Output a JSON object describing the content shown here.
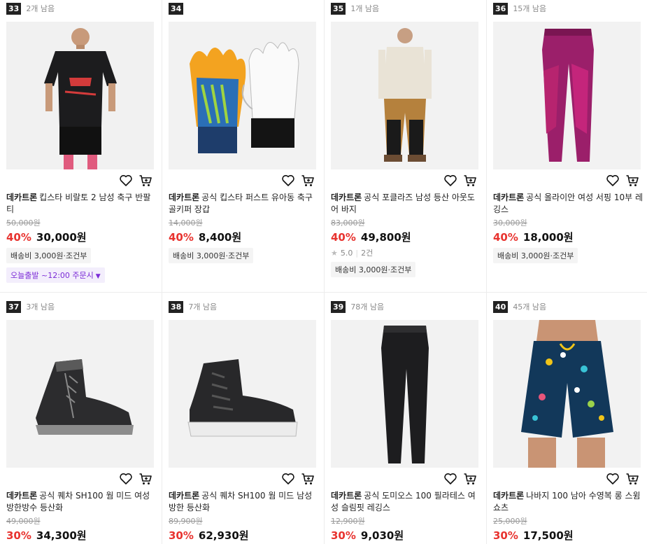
{
  "products": [
    {
      "rank": "33",
      "stock": "2개 남음",
      "brand": "데카트론",
      "name": "킵스타 비랄토 2 남성 축구 반팔티",
      "original_price": "50,000원",
      "discount": "40%",
      "price": "30,000원",
      "shipping": "배송비 3,000원·조건부",
      "promo": "오늘출발 ~12:00 주문시",
      "image": "soccer-shirt"
    },
    {
      "rank": "34",
      "stock": "",
      "brand": "데카트론",
      "name": "공식 킵스타 퍼스트 유아동 축구 골키퍼 장갑",
      "original_price": "14,000원",
      "discount": "40%",
      "price": "8,400원",
      "shipping": "배송비 3,000원·조건부",
      "image": "goalkeeper-gloves"
    },
    {
      "rank": "35",
      "stock": "1개 남음",
      "brand": "데카트론",
      "name": "공식 포클라즈 남성 등산 아웃도어 바지",
      "original_price": "83,000원",
      "discount": "40%",
      "price": "49,800원",
      "rating": "5.0",
      "reviews": "2건",
      "shipping": "배송비 3,000원·조건부",
      "image": "hiking-pants"
    },
    {
      "rank": "36",
      "stock": "15개 남음",
      "brand": "데카트론",
      "name": "공식 올라이안 여성 서핑 10부 레깅스",
      "original_price": "30,000원",
      "discount": "40%",
      "price": "18,000원",
      "shipping": "배송비 3,000원·조건부",
      "image": "surf-leggings"
    },
    {
      "rank": "37",
      "stock": "3개 남음",
      "brand": "데카트론",
      "name": "공식 퀘차 SH100 웜 미드 여성 방한방수 등산화",
      "original_price": "49,000원",
      "discount": "30%",
      "price": "34,300원",
      "image": "womens-boot"
    },
    {
      "rank": "38",
      "stock": "7개 남음",
      "brand": "데카트론",
      "name": "공식 퀘차 SH100 웜 미드 남성 방한 등산화",
      "original_price": "89,900원",
      "discount": "30%",
      "price": "62,930원",
      "image": "mens-boot"
    },
    {
      "rank": "39",
      "stock": "78개 남음",
      "brand": "데카트론",
      "name": "공식 도미오스 100 필라테스 여성 슬림핏 레깅스",
      "original_price": "12,900원",
      "discount": "30%",
      "price": "9,030원",
      "image": "pilates-leggings"
    },
    {
      "rank": "40",
      "stock": "45개 남음",
      "brand": "데카트론",
      "name": "나바지 100 남아 수영복 롱 스윔 쇼츠",
      "original_price": "25,000원",
      "discount": "30%",
      "price": "17,500원",
      "image": "swim-shorts"
    }
  ]
}
